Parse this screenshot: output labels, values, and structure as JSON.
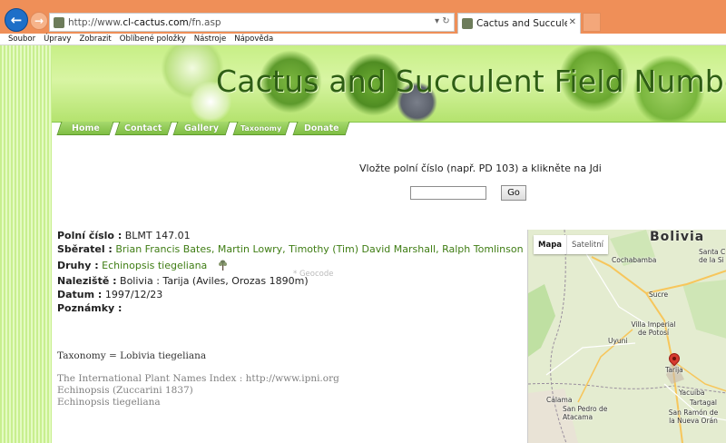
{
  "browser": {
    "back_icon": "back-arrow-icon",
    "forward_icon": "forward-arrow-icon",
    "address_prefix": "http://www.",
    "address_domain": "cl-cactus.com",
    "address_path": "/fn.asp",
    "address_controls": "▾ ↻",
    "tab_title": "Cactus and Succulent Field ...",
    "tab_close": "✕",
    "menu": [
      "Soubor",
      "Úpravy",
      "Zobrazit",
      "Oblíbené položky",
      "Nástroje",
      "Nápověda"
    ]
  },
  "site": {
    "title": "Cactus and Succulent Field Number",
    "nav": [
      "Home",
      "Contact",
      "Gallery",
      "Taxonomy",
      "Donate"
    ]
  },
  "search": {
    "prompt": "Vložte polní číslo (např. PD 103) a klikněte na Jdi",
    "input_value": "",
    "button_label": "Go"
  },
  "record": {
    "field_number_label": "Polní číslo :",
    "field_number_value": "BLMT 147.01",
    "collector_label": "Sběratel :",
    "collector_value": "Brian Francis Bates, Martin Lowry, Timothy (Tim) David Marshall, Ralph Tomlinson",
    "species_label": "Druhy :",
    "species_value": "Echinopsis tiegeliana",
    "species_icon": "plant-icon",
    "locality_label": "Naleziště :",
    "locality_value": "Bolivia : Tarija (Aviles, Orozas 1890m)",
    "geocode_link": "* Geocode",
    "date_label": "Datum :",
    "date_value": "1997/12/23",
    "notes_label": "Poznámky :",
    "notes_value": ""
  },
  "taxonomy_line": "Taxonomy = Lobivia tiegeliana",
  "ipni": {
    "line1": "The International Plant Names Index : http://www.ipni.org",
    "line2": "Echinopsis (Zuccarini 1837)",
    "line3": "Echinopsis tiegeliana"
  },
  "map": {
    "toggle_map": "Mapa",
    "toggle_satellite": "Satelitní",
    "country": "Bolivia",
    "labels": [
      "Cochabamba",
      "Santa C de la Si",
      "Sucre",
      "Villa Imperial de Potosí",
      "Uyuni",
      "Tarija",
      "Calama",
      "San Pedro de Atacama",
      "Yacuiba",
      "Tartagal",
      "San Ramón de la Nueva Orán"
    ],
    "pin_icon": "map-pin-icon",
    "colors": {
      "land": "#dfe8c9",
      "park": "#bfe0a2",
      "road": "#f7c65b",
      "border": "#9a8f9e",
      "pin": "#d63a2f"
    }
  },
  "colors": {
    "chrome": "#ef8f58",
    "banner_green": "#c7ef86",
    "title_text": "#2e5e14",
    "nav_green": "#7fbe44",
    "link_green": "#3f7d14"
  }
}
